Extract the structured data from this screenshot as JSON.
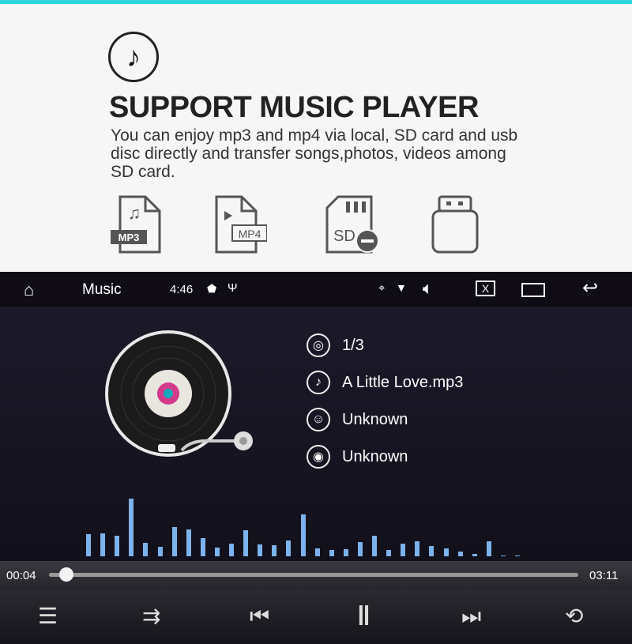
{
  "promo": {
    "title": "SUPPORT  MUSIC PLAYER",
    "description": "You can enjoy mp3 and mp4 via local, SD card and usb disc directly and transfer songs,photos, videos among SD card.",
    "formats": [
      {
        "icon": "mp3-file-icon",
        "label": "MP3"
      },
      {
        "icon": "mp4-file-icon",
        "label": "MP4"
      },
      {
        "icon": "sd-card-icon",
        "label": "SD"
      },
      {
        "icon": "usb-drive-icon",
        "label": ""
      }
    ]
  },
  "status_bar": {
    "app_title": "Music",
    "time": "4:46"
  },
  "track": {
    "index": "1/3",
    "title": "A Little Love.mp3",
    "artist": "Unknown",
    "album": "Unknown"
  },
  "progress": {
    "elapsed": "00:04",
    "total": "03:11",
    "fraction": 0.02
  },
  "visualizer": {
    "color": "#7db3ec",
    "levels": [
      28,
      29,
      26,
      73,
      17,
      12,
      37,
      34,
      23,
      11,
      16,
      33,
      15,
      14,
      20,
      53,
      10,
      8,
      9,
      18,
      26,
      8,
      16,
      19,
      13,
      10,
      6,
      3,
      19,
      1,
      1
    ]
  },
  "accent": "#2ad4dc"
}
